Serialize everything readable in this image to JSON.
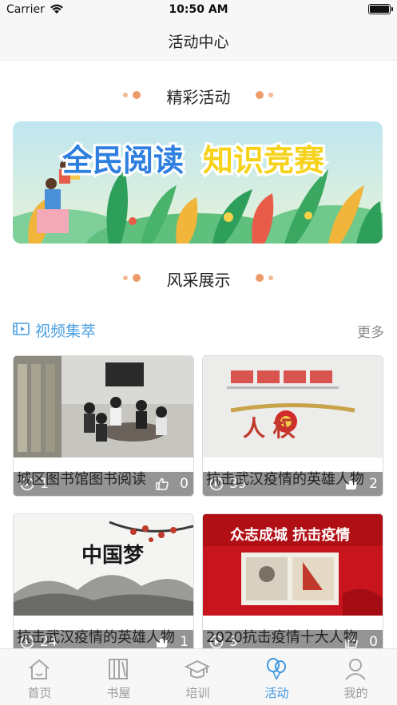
{
  "status_bar": {
    "carrier": "Carrier",
    "time": "10:50 AM"
  },
  "nav": {
    "title": "活动中心"
  },
  "sections": {
    "highlights": "精彩活动",
    "showcase": "风采展示"
  },
  "banner": {
    "text_part1": "全民阅读",
    "text_part2": "知识竞赛",
    "colors": {
      "sky_top": "#bfe6f0",
      "sky_bottom": "#e8f3d7",
      "text_blue": "#2e7fe0",
      "text_yellow": "#f7d21a"
    }
  },
  "video": {
    "section_title": "视频集萃",
    "more_label": "更多",
    "icons": {
      "section": "film-icon",
      "play": "play-circle-icon",
      "like": "thumbs-up-icon"
    },
    "items": [
      {
        "title": "城区图书馆图书阅读",
        "plays": "1",
        "likes": "0"
      },
      {
        "title": "抗击武汉疫情的英雄人物",
        "plays": "39",
        "likes": "2",
        "thumb_text": "人 权"
      },
      {
        "title": "抗击武汉疫情的英雄人物",
        "plays": "24",
        "likes": "1",
        "thumb_text": "中国梦"
      },
      {
        "title": "2020抗击疫情十大人物",
        "plays": "3",
        "likes": "0",
        "thumb_text": "众志成城 抗击疫情"
      }
    ]
  },
  "tabbar": {
    "active_color": "#3f97e0",
    "items": [
      {
        "label": "首页",
        "icon": "home-icon"
      },
      {
        "label": "书屋",
        "icon": "bookshelf-icon"
      },
      {
        "label": "培训",
        "icon": "graduation-cap-icon"
      },
      {
        "label": "活动",
        "icon": "balloons-icon",
        "active": true
      },
      {
        "label": "我的",
        "icon": "person-icon"
      }
    ]
  }
}
